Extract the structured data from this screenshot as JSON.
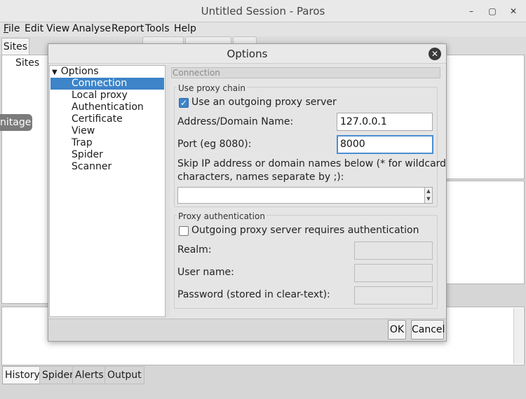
{
  "window": {
    "title": "Untitled Session - Paros"
  },
  "window_controls": {
    "minimize": "–",
    "maximize": "▢",
    "close": "✕"
  },
  "menu": [
    {
      "first": "F",
      "rest": "ile"
    },
    {
      "first": "",
      "rest": "Edit"
    },
    {
      "first": "",
      "rest": "View"
    },
    {
      "first": "",
      "rest": "Analyse"
    },
    {
      "first": "",
      "rest": "Report"
    },
    {
      "first": "",
      "rest": "Tools"
    },
    {
      "first": "",
      "rest": "Help"
    }
  ],
  "left_panel": {
    "tab": "Sites",
    "tree_root": "Sites",
    "overlay_label": "nitage"
  },
  "bottom_tabs": [
    "History",
    "Spider",
    "Alerts",
    "Output"
  ],
  "dialog": {
    "title": "Options",
    "close_icon": "✕",
    "tree": {
      "expand_icon": "▼",
      "root": "Options",
      "items": [
        "Connection",
        "Local proxy",
        "Authentication",
        "Certificate",
        "View",
        "Trap",
        "Spider",
        "Scanner"
      ],
      "selected": "Connection"
    },
    "connection": {
      "header": "Connection",
      "proxy_chain": {
        "title": "Use proxy chain",
        "use_proxy_label": "Use an outgoing proxy server",
        "use_proxy_checked": true,
        "address_label": "Address/Domain Name:",
        "address_value": "127.0.0.1",
        "port_label": "Port (eg 8080):",
        "port_value": "8000",
        "skip_label_line1": "Skip IP address or domain names below (* for wildcard",
        "skip_label_line2": "characters, names separate by ;):",
        "skip_value": "",
        "scroll_up": "▲",
        "scroll_down": "▼"
      },
      "proxy_auth": {
        "title": "Proxy authentication",
        "requires_auth_label": "Outgoing proxy server requires authentication",
        "requires_auth_checked": false,
        "realm_label": "Realm:",
        "user_label": "User name:",
        "password_label": "Password (stored in clear-text):"
      }
    },
    "buttons": {
      "ok": "OK",
      "cancel": "Cancel"
    }
  },
  "colors": {
    "selection": "#3d84c8",
    "focus_border": "#4a8fd2"
  }
}
